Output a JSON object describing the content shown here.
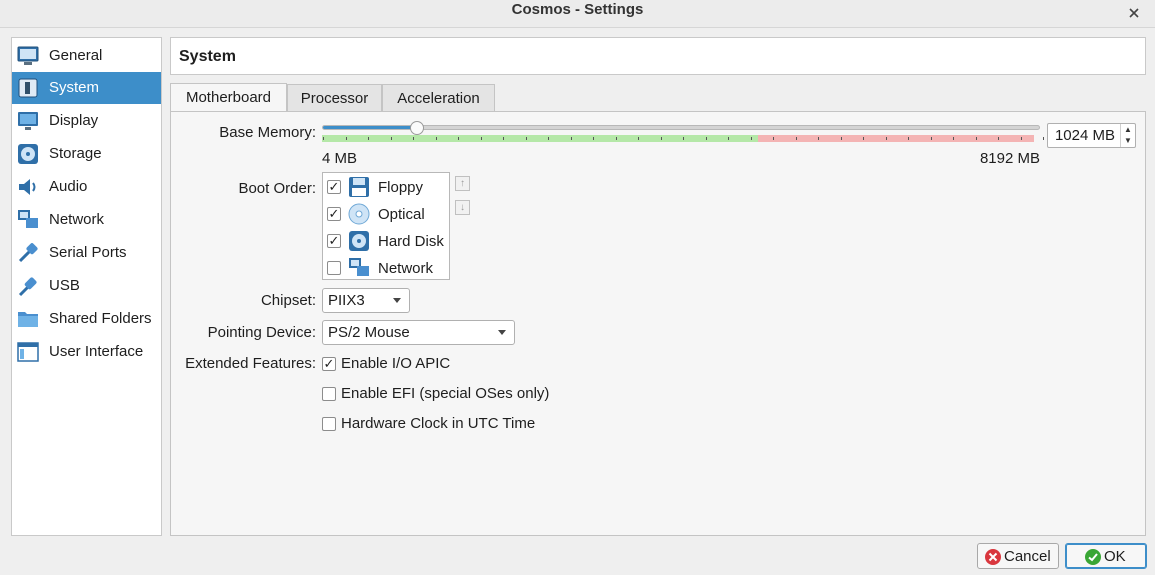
{
  "window": {
    "title": "Cosmos - Settings"
  },
  "header": {
    "title": "System"
  },
  "sidebar": {
    "items": [
      {
        "label": "General",
        "icon": "monitor-general-icon",
        "selected": false
      },
      {
        "label": "System",
        "icon": "system-chip-icon",
        "selected": true
      },
      {
        "label": "Display",
        "icon": "display-monitor-icon",
        "selected": false
      },
      {
        "label": "Storage",
        "icon": "storage-disk-icon",
        "selected": false
      },
      {
        "label": "Audio",
        "icon": "audio-speaker-icon",
        "selected": false
      },
      {
        "label": "Network",
        "icon": "network-icon",
        "selected": false
      },
      {
        "label": "Serial Ports",
        "icon": "serial-ports-icon",
        "selected": false
      },
      {
        "label": "USB",
        "icon": "usb-icon",
        "selected": false
      },
      {
        "label": "Shared Folders",
        "icon": "shared-folder-icon",
        "selected": false
      },
      {
        "label": "User Interface",
        "icon": "user-interface-icon",
        "selected": false
      }
    ]
  },
  "tabs": [
    {
      "label": "Motherboard",
      "active": true
    },
    {
      "label": "Processor",
      "active": false
    },
    {
      "label": "Acceleration",
      "active": false
    }
  ],
  "motherboard": {
    "base_memory": {
      "label": "Base Memory:",
      "value_text": "1024 MB",
      "value_mb": 1024,
      "min_label": "4 MB",
      "max_label": "8192 MB",
      "min_mb": 4,
      "max_mb": 8192
    },
    "boot_order": {
      "label": "Boot Order:",
      "items": [
        {
          "label": "Floppy",
          "checked": true,
          "icon": "floppy-disk-icon"
        },
        {
          "label": "Optical",
          "checked": true,
          "icon": "optical-disc-icon"
        },
        {
          "label": "Hard Disk",
          "checked": true,
          "icon": "hard-disk-icon"
        },
        {
          "label": "Network",
          "checked": false,
          "icon": "network-boot-icon"
        }
      ]
    },
    "chipset": {
      "label": "Chipset:",
      "value": "PIIX3"
    },
    "pointing_device": {
      "label": "Pointing Device:",
      "value": "PS/2 Mouse"
    },
    "extended_features": {
      "label": "Extended Features:",
      "items": [
        {
          "label": "Enable I/O APIC",
          "checked": true
        },
        {
          "label": "Enable EFI (special OSes only)",
          "checked": false
        },
        {
          "label": "Hardware Clock in UTC Time",
          "checked": false
        }
      ]
    }
  },
  "buttons": {
    "cancel": "Cancel",
    "ok": "OK"
  },
  "colors": {
    "accent": "#3d8ec9",
    "memory_safe": "#b5e8a8",
    "memory_danger": "#f4b4b4",
    "cancel_icon": "#d9373e",
    "ok_icon": "#3aa635"
  }
}
